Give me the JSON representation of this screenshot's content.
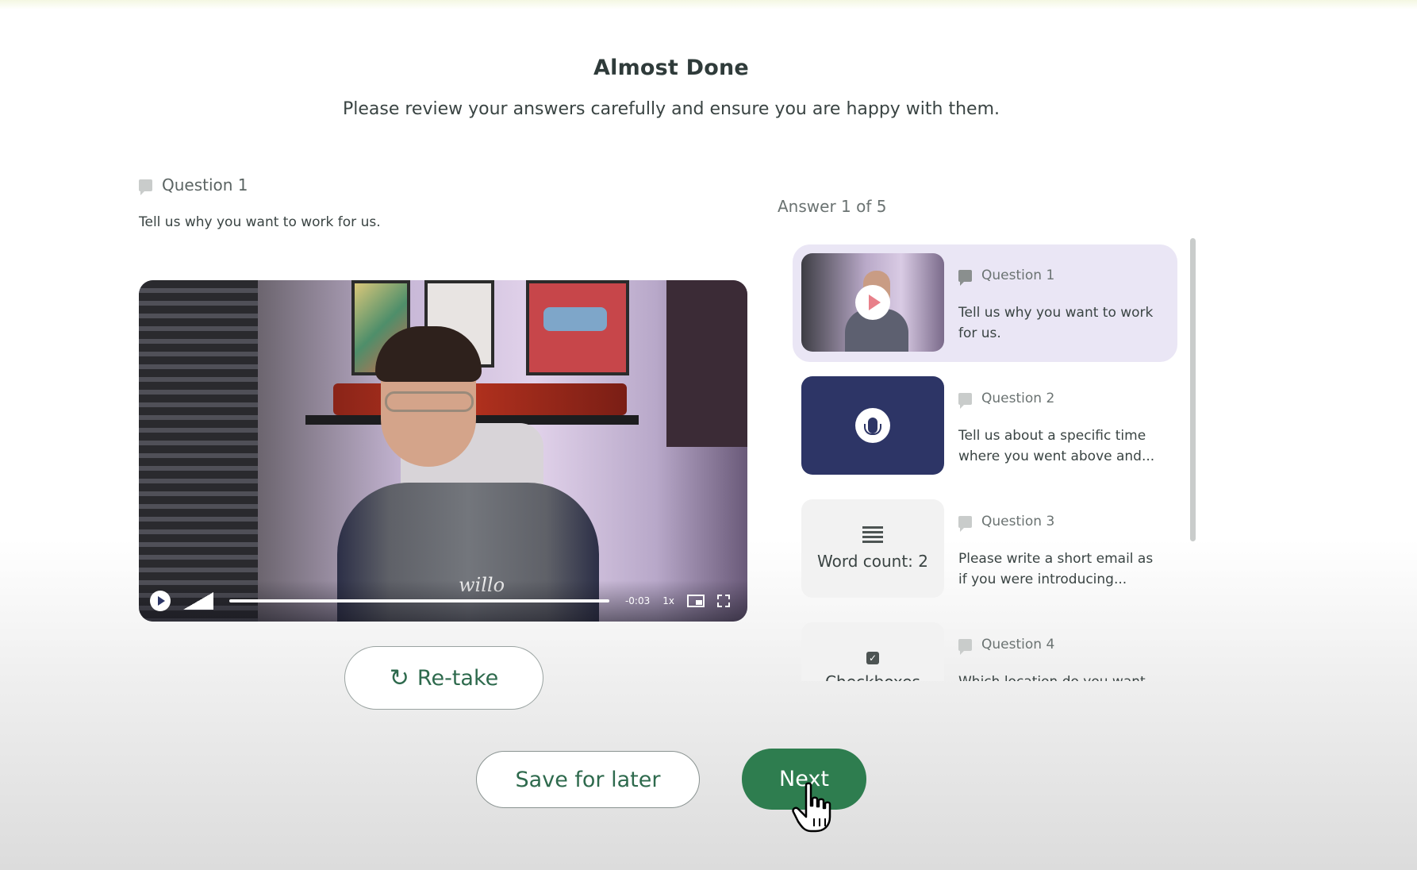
{
  "header": {
    "title": "Almost Done",
    "subtitle": "Please review your answers carefully and ensure you are happy with them."
  },
  "current_question": {
    "label": "Question 1",
    "text": "Tell us why you want to work for us."
  },
  "video_player": {
    "time_remaining": "-0:03",
    "speed": "1x",
    "brand_text": "willo"
  },
  "actions": {
    "retake_label": "Re-take",
    "save_label": "Save for later",
    "next_label": "Next"
  },
  "answers": {
    "counter": "Answer 1 of 5",
    "items": [
      {
        "label": "Question 1",
        "text": "Tell us why you want to work for us.",
        "type": "video"
      },
      {
        "label": "Question 2",
        "text": "Tell us about a specific time where you went above and...",
        "type": "audio"
      },
      {
        "label": "Question 3",
        "text": "Please write a short email as if you were introducing...",
        "type": "text",
        "thumb_label": "Word count: 2"
      },
      {
        "label": "Question 4",
        "text": "Which location do you want",
        "type": "checkboxes",
        "thumb_label": "Checkboxes"
      }
    ]
  },
  "colors": {
    "primary_green": "#2e7d4f",
    "audio_navy": "#2d3566",
    "active_card": "#eae6f5"
  }
}
